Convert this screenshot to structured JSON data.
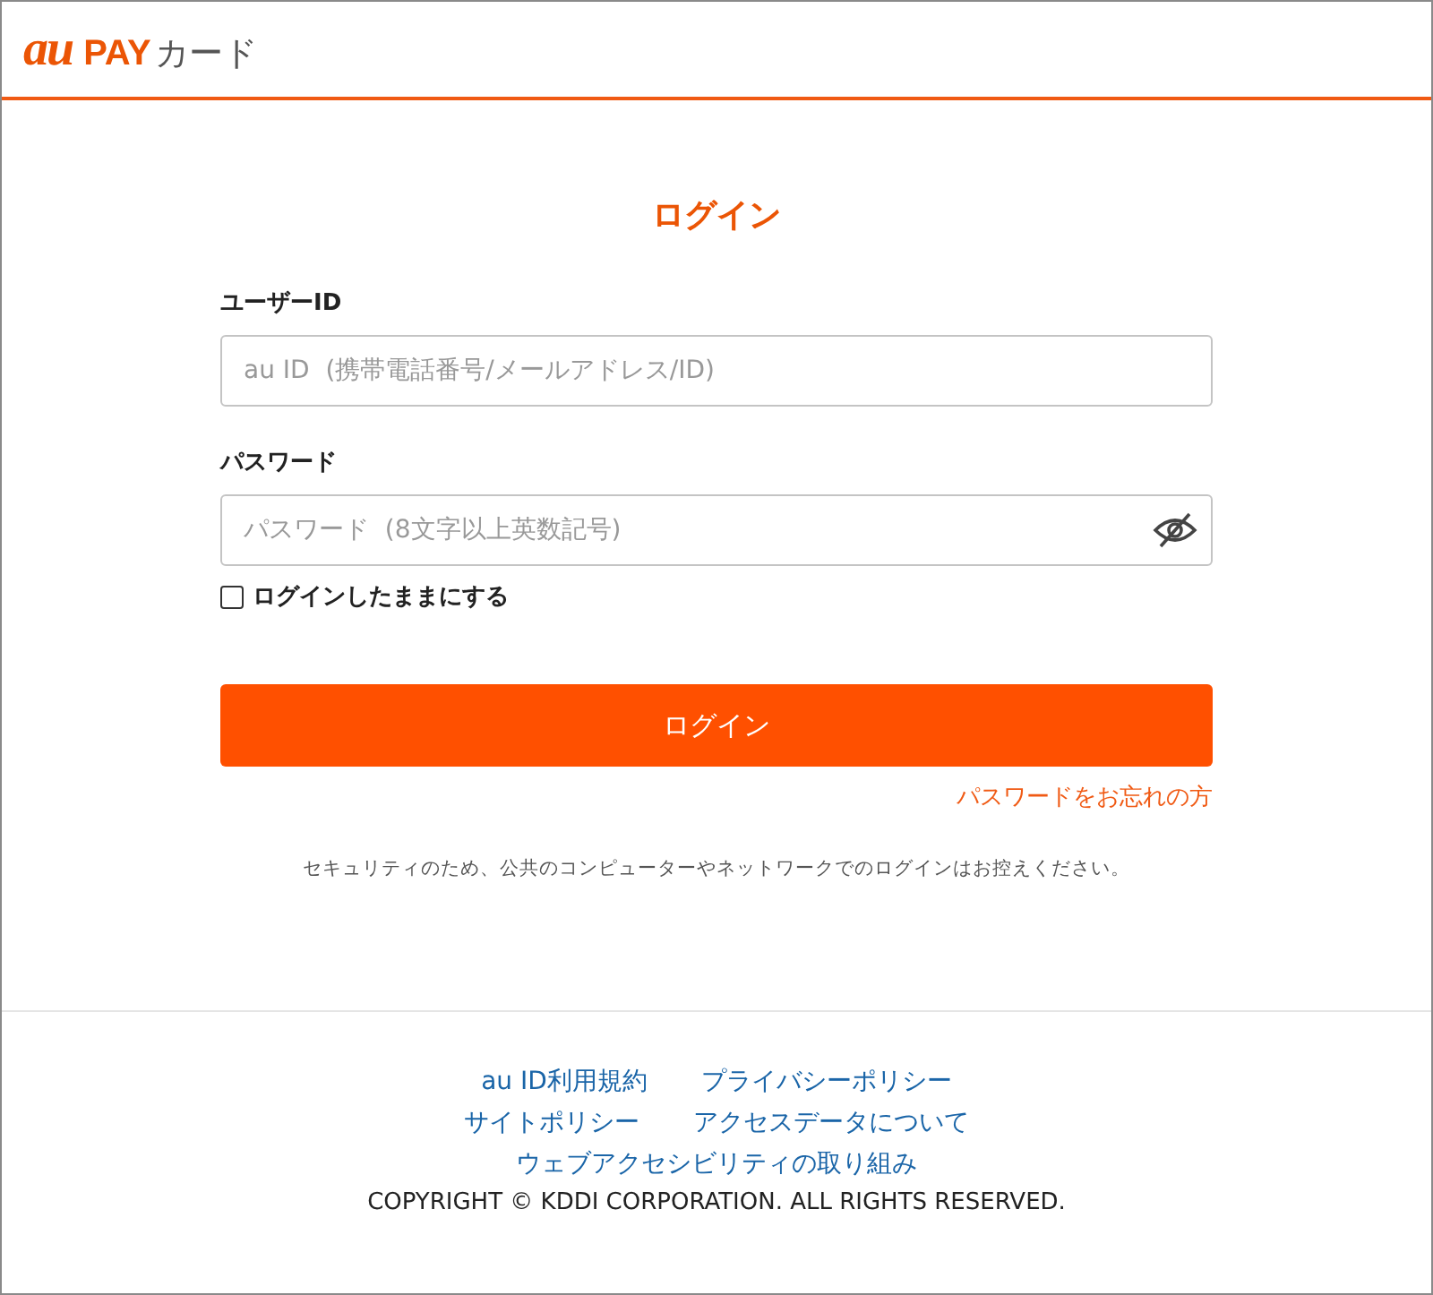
{
  "header": {
    "logo": {
      "mark": "au",
      "brand": "PAY",
      "product": "カード"
    }
  },
  "form": {
    "title": "ログイン",
    "fields": [
      {
        "label": "ユーザーID",
        "placeholder": "au ID  (携帯電話番号/メールアドレス/ID)",
        "kind": "text"
      },
      {
        "label": "パスワード",
        "placeholder": "パスワード  (8文字以上英数記号)",
        "kind": "password"
      }
    ],
    "remember": {
      "label": "ログインしたままにする",
      "checked": false
    },
    "submit": "ログイン",
    "forgot_link": "パスワードをお忘れの方",
    "notice": "セキュリティのため、公共のコンピューターやネットワークでのログインはお控えください。"
  },
  "footer": {
    "link_rows": [
      [
        "au ID利用規約",
        "プライバシーポリシー"
      ],
      [
        "サイトポリシー",
        "アクセスデータについて"
      ],
      [
        "ウェブアクセシビリティの取り組み"
      ]
    ],
    "copyright": "COPYRIGHT © KDDI CORPORATION. ALL RIGHTS RESERVED."
  }
}
